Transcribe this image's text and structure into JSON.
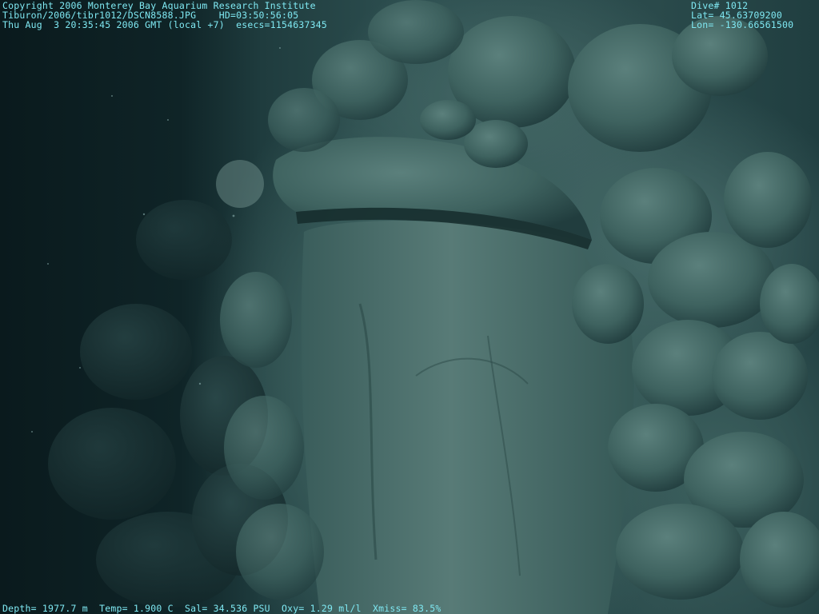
{
  "header_left": {
    "line1": "Copyright 2006 Monterey Bay Aquarium Research Institute",
    "line2": "Tiburon/2006/tibr1012/DSCN8588.JPG    HD=03:50:56:05",
    "line3": "Thu Aug  3 20:35:45 2006 GMT (local +7)  esecs=1154637345"
  },
  "header_right": {
    "dive": "Dive# 1012",
    "lat": "Lat= 45.63709200",
    "lon": "Lon= -130.66561500"
  },
  "footer": {
    "telemetry": "Depth= 1977.7 m  Temp= 1.900 C  Sal= 34.536 PSU  Oxy= 1.29 ml/l  Xmiss= 83.5%"
  },
  "colors": {
    "overlay_text": "#7fe8f2",
    "water_dark": "#0a1a1d",
    "rock_light": "#4f7471",
    "rock_mid": "#3d615f"
  }
}
